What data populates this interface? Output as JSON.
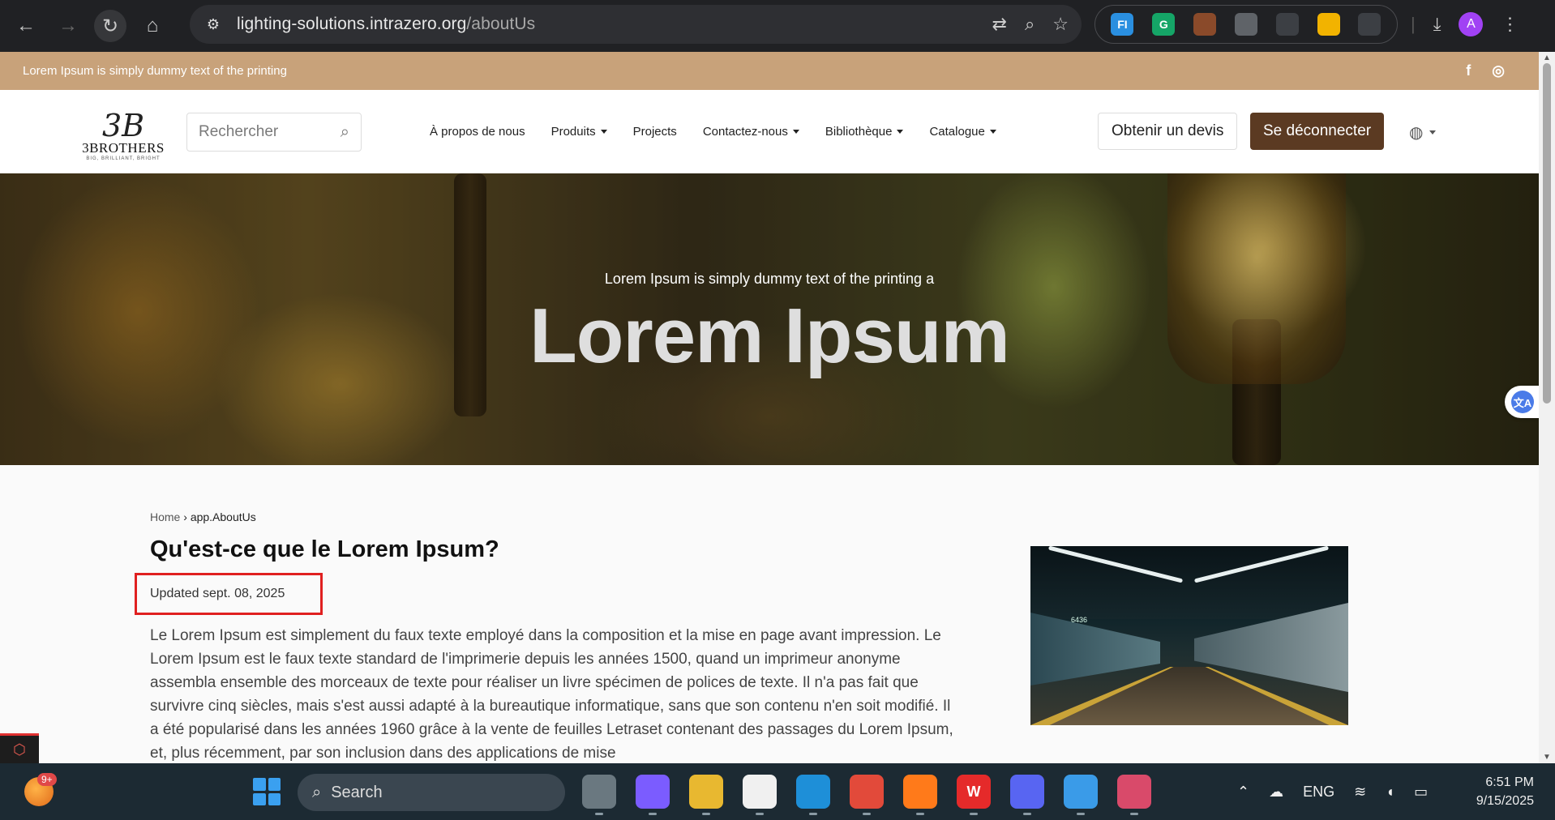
{
  "browser": {
    "url_host": "lighting-solutions.intrazero.org",
    "url_path": "/aboutUs",
    "profile_initial": "A",
    "extensions": [
      {
        "name": "fi-extension-icon",
        "label": "FI",
        "color": "#2a8fe0"
      },
      {
        "name": "grammarly-icon",
        "label": "G",
        "color": "#15a567"
      },
      {
        "name": "coconut-extension-icon",
        "label": "",
        "color": "#8a4a2a"
      },
      {
        "name": "camera-icon",
        "label": "",
        "color": "#5f6368"
      },
      {
        "name": "glasses-icon",
        "label": "",
        "color": "#3c3f44"
      },
      {
        "name": "face-extension-icon",
        "label": "",
        "color": "#f2b300"
      },
      {
        "name": "puzzle-icon",
        "label": "",
        "color": "#3c3f44"
      }
    ]
  },
  "topbar": {
    "message": "Lorem Ipsum is simply dummy text of the printing"
  },
  "header": {
    "logo_mark": "3B",
    "logo_brand": "3BROTHERS",
    "logo_tagline": "BIG, BRILLIANT, BRIGHT",
    "search_placeholder": "Rechercher",
    "menu": [
      {
        "label": "À propos de nous",
        "dropdown": false
      },
      {
        "label": "Produits",
        "dropdown": true
      },
      {
        "label": "Projects",
        "dropdown": false
      },
      {
        "label": "Contactez-nous",
        "dropdown": true
      },
      {
        "label": "Bibliothèque",
        "dropdown": true
      },
      {
        "label": "Catalogue",
        "dropdown": true
      }
    ],
    "quote_button": "Obtenir un devis",
    "logout_button": "Se déconnecter"
  },
  "hero": {
    "subtitle": "Lorem Ipsum is simply dummy text of the printing a",
    "title": "Lorem Ipsum"
  },
  "content": {
    "breadcrumb_home": "Home",
    "breadcrumb_sep": "›",
    "breadcrumb_current": "app.AboutUs",
    "title": "Qu'est-ce que le Lorem Ipsum?",
    "updated": "Updated sept. 08, 2025",
    "body": "Le Lorem Ipsum est simplement du faux texte employé dans la composition et la mise en page avant impression. Le Lorem Ipsum est le faux texte standard de l'imprimerie depuis les années 1500, quand un imprimeur anonyme assembla ensemble des morceaux de texte pour réaliser un livre spécimen de polices de texte. Il n'a pas fait que survivre cinq siècles, mais s'est aussi adapté à la bureautique informatique, sans que son contenu n'en soit modifié. Il a été popularisé dans les années 1960 grâce à la vente de feuilles Letraset contenant des passages du Lorem Ipsum, et, plus récemment, par son inclusion dans des applications de mise",
    "image_text": "6436"
  },
  "taskbar": {
    "widget_badge": "9+",
    "search_label": "Search",
    "language": "ENG",
    "time": "6:51 PM",
    "date": "9/15/2025",
    "apps": [
      {
        "name": "task-view-icon",
        "label": "",
        "color": "#6a7880"
      },
      {
        "name": "copilot-icon",
        "label": "",
        "color": "#7b5cff"
      },
      {
        "name": "file-explorer-icon",
        "label": "",
        "color": "#e8b830"
      },
      {
        "name": "microsoft-store-icon",
        "label": "",
        "color": "#f0f0f0"
      },
      {
        "name": "edge-icon",
        "label": "",
        "color": "#1e8fd8"
      },
      {
        "name": "chrome-icon",
        "label": "",
        "color": "#e24a3a"
      },
      {
        "name": "firefox-icon",
        "label": "",
        "color": "#ff7a1a"
      },
      {
        "name": "wps-office-icon",
        "label": "W",
        "color": "#e52a2a"
      },
      {
        "name": "discord-icon",
        "label": "",
        "color": "#5865f2"
      },
      {
        "name": "photos-icon",
        "label": "",
        "color": "#3a9be8"
      },
      {
        "name": "snipping-tool-icon",
        "label": "",
        "color": "#d94a6a"
      }
    ]
  }
}
